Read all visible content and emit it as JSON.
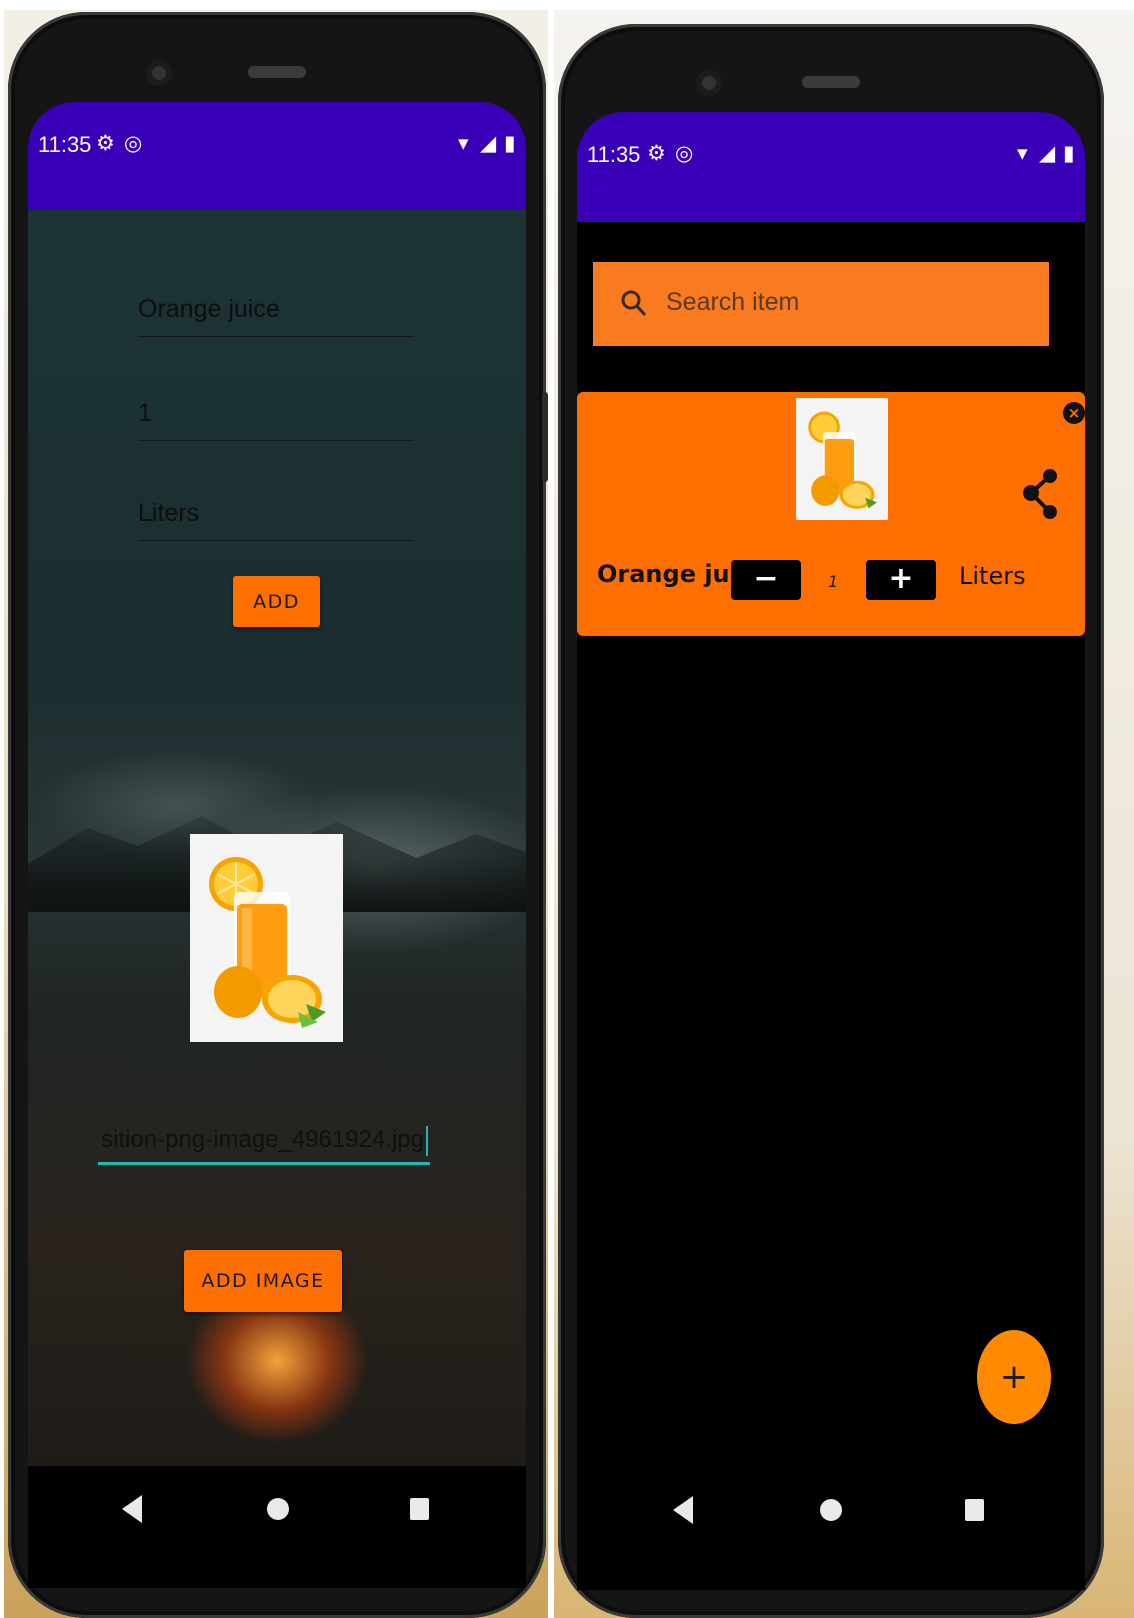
{
  "status_bar": {
    "time": "11:35",
    "gear_glyph": "⚙",
    "sync_glyph": "◎",
    "wifi_glyph": "▾",
    "signal_glyph": "◢",
    "battery_glyph": "▮"
  },
  "add_screen": {
    "name_value": "Orange juice",
    "quantity_value": "1",
    "unit_value": "Liters",
    "add_label": "ADD",
    "image_filename": "sition-png-image_4961924.jpg",
    "add_image_label": "ADD IMAGE"
  },
  "list_screen": {
    "search_placeholder": "Search item",
    "item": {
      "name": "Orange juice",
      "minus_label": "−",
      "quantity": "1",
      "plus_label": "+",
      "unit": "Liters",
      "close_label": "×"
    },
    "fab_label": "+"
  },
  "nav": {
    "back": "back",
    "home": "home",
    "recents": "recents"
  },
  "colors": {
    "status_bar": "#3a00b8",
    "accent_orange": "#ff6f00",
    "cursor_teal": "#1bb7b0"
  }
}
